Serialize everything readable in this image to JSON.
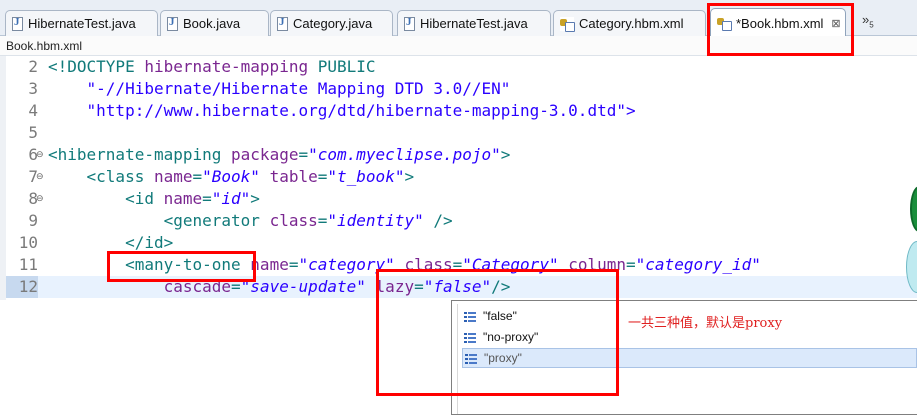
{
  "tabs": [
    {
      "label": "HibernateTest.java",
      "icon": "java-file-icon"
    },
    {
      "label": "Book.java",
      "icon": "java-file-icon"
    },
    {
      "label": "Category.java",
      "icon": "java-file-icon"
    },
    {
      "label": "HibernateTest.java",
      "icon": "java-file-icon"
    },
    {
      "label": "Category.hbm.xml",
      "icon": "xml-file-icon"
    },
    {
      "label": "*Book.hbm.xml",
      "icon": "xml-file-icon",
      "active": true,
      "close": "⊠"
    }
  ],
  "tab_overflow": {
    "symbol": "»",
    "count": "5"
  },
  "breadcrumb": "Book.hbm.xml",
  "editor": {
    "lines": [
      {
        "num": "2",
        "fold": ""
      },
      {
        "num": "3",
        "fold": ""
      },
      {
        "num": "4",
        "fold": ""
      },
      {
        "num": "5",
        "fold": ""
      },
      {
        "num": "6",
        "fold": "⊖"
      },
      {
        "num": "7",
        "fold": "⊖"
      },
      {
        "num": "8",
        "fold": "⊖"
      },
      {
        "num": "9",
        "fold": ""
      },
      {
        "num": "10",
        "fold": ""
      },
      {
        "num": "11",
        "fold": ""
      },
      {
        "num": "12",
        "fold": ""
      }
    ],
    "code": {
      "l2": {
        "a": "<!DOCTYPE ",
        "b": "hibernate-mapping",
        "c": " PUBLIC"
      },
      "l3": "    \"-//Hibernate/Hibernate Mapping DTD 3.0//EN\"",
      "l4": "    \"http://www.hibernate.org/dtd/hibernate-mapping-3.0.dtd\">",
      "l6": {
        "tag": "<hibernate-mapping ",
        "attr": "package",
        "eq": "=",
        "val": "\"com.myeclipse.pojo\"",
        "end": ">"
      },
      "l7": {
        "indent": "    ",
        "tag": "<class ",
        "attr1": "name",
        "eq1": "=",
        "val1": "\"Book\"",
        "sp": " ",
        "attr2": "table",
        "eq2": "=",
        "val2": "\"t_book\"",
        "end": ">"
      },
      "l8": {
        "indent": "        ",
        "tag": "<id ",
        "attr": "name",
        "eq": "=",
        "val": "\"id\"",
        "end": ">"
      },
      "l9": {
        "indent": "            ",
        "tag": "<generator ",
        "attr": "class",
        "eq": "=",
        "val": "\"identity\"",
        "end": " />"
      },
      "l10": {
        "indent": "        ",
        "tag": "</id>"
      },
      "l11": {
        "indent": "        ",
        "tag": "<many-to-one",
        "sp": " ",
        "attr1": "name",
        "eq1": "=",
        "val1": "\"category\"",
        "sp2": " ",
        "attr2": "class",
        "eq2": "=",
        "val2": "\"Category\"",
        "sp3": " ",
        "attr3": "column",
        "eq3": "=",
        "val3": "\"category_id\""
      },
      "l12": {
        "indent": "            ",
        "attr1": "cascade",
        "eq1": "=",
        "val1": "\"save-update\"",
        "sp": " ",
        "attr2": "lazy",
        "eq2": "=",
        "val2": "\"false\"",
        "end": "/>"
      }
    }
  },
  "autocomplete": {
    "items": [
      "\"false\"",
      "\"no-proxy\"",
      "\"proxy\""
    ],
    "selected_index": 2
  },
  "annotation": "一共三种值，默认是proxy",
  "colors": {
    "highlight": "#ff0000",
    "tag": "#117a7a",
    "attribute": "#7a2690",
    "value": "#2a00ff"
  }
}
